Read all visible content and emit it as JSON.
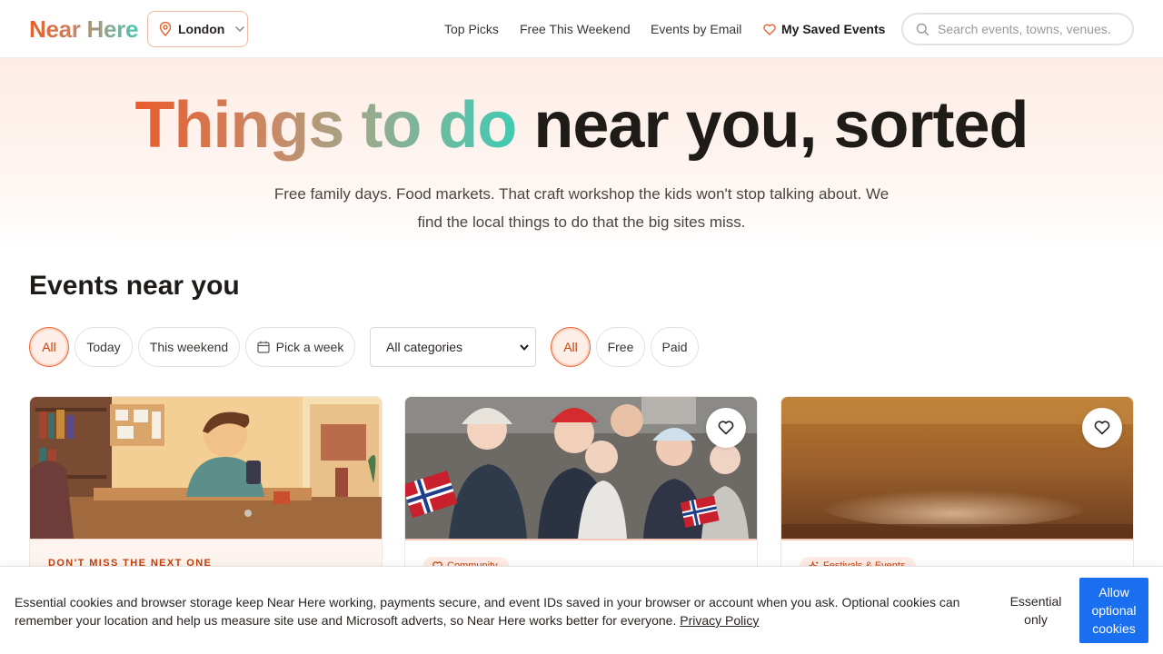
{
  "header": {
    "logo": "Near Here",
    "location": "London",
    "nav": [
      "Top Picks",
      "Free This Weekend",
      "Events by Email"
    ],
    "saved_label": "My Saved Events",
    "search_placeholder": "Search events, towns, venues..."
  },
  "hero": {
    "title_accent": "Things to do",
    "title_rest": " near you, sorted",
    "subtitle": "Free family days. Food markets. That craft workshop the kids won't stop talking about. We find the local things to do that the big sites miss."
  },
  "events": {
    "title": "Events near you",
    "date_filters": [
      "All",
      "Today",
      "This weekend",
      "Pick a week"
    ],
    "category_selected": "All categories",
    "price_filters": [
      "All",
      "Free",
      "Paid"
    ],
    "cards": [
      {
        "kicker": "DON'T MISS THE NEXT ONE",
        "image": "illustration-person-with-phone"
      },
      {
        "tag": "Community",
        "tag_icon": "heart-icon",
        "image": "photo-group-with-norwegian-flags"
      },
      {
        "tag": "Festivals & Events",
        "tag_icon": "sparkle-icon",
        "image": "photo-blurred-venue"
      }
    ]
  },
  "cookie": {
    "text": "Essential cookies and browser storage keep Near Here working, payments secure, and event IDs saved in your browser or account when you ask. Optional cookies can remember your location and help us measure site use and Microsoft adverts, so Near Here works better for everyone.",
    "policy_link": "Privacy Policy",
    "essential_label": "Essential only",
    "allow_label": "Allow optional cookies"
  },
  "colors": {
    "accent": "#e8602c",
    "teal": "#40cbb4",
    "allow_button": "#1a6ff0"
  }
}
